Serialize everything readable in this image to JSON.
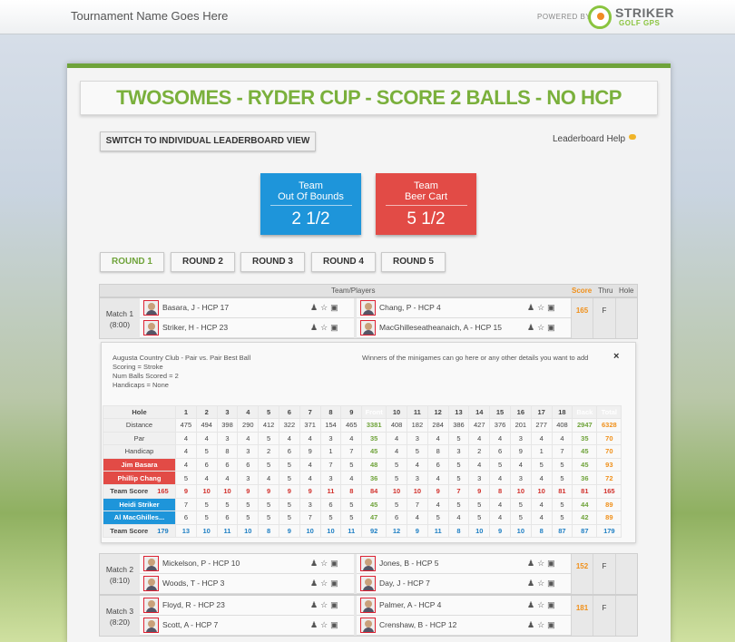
{
  "header": {
    "tournament_name": "Tournament Name Goes Here",
    "powered_by": "POWERED BY",
    "logo_word1": "STRIKER",
    "logo_word2": "GOLF GPS"
  },
  "title": "TWOSOMES - RYDER CUP - SCORE 2 BALLS - NO HCP",
  "switch_button": "SWITCH TO INDIVIDUAL LEADERBOARD VIEW",
  "help_link": "Leaderboard Help",
  "teams": [
    {
      "line1": "Team",
      "line2": "Out Of Bounds",
      "score": "2 1/2",
      "color": "#1e95da"
    },
    {
      "line1": "Team",
      "line2": "Beer Cart",
      "score": "5 1/2",
      "color": "#e24b46"
    }
  ],
  "rounds": [
    "ROUND 1",
    "ROUND 2",
    "ROUND 3",
    "ROUND 4",
    "ROUND 5"
  ],
  "active_round": "ROUND 1",
  "columns": {
    "players": "Team/Players",
    "score": "Score",
    "thru": "Thru",
    "hole": "Hole"
  },
  "matches": [
    {
      "label": "Match 1",
      "time": "(8:00)",
      "left": [
        "Basara, J - HCP 17",
        "Striker, H - HCP 23"
      ],
      "right": [
        "Chang, P - HCP 4",
        "MacGhilleseatheanaich, A - HCP 15"
      ],
      "score": "165",
      "thru": "F",
      "hole": ""
    },
    {
      "label": "Match 2",
      "time": "(8:10)",
      "left": [
        "Mickelson, P - HCP 10",
        "Woods, T - HCP 3"
      ],
      "right": [
        "Jones, B - HCP 5",
        "Day, J - HCP 7"
      ],
      "score": "152",
      "thru": "F",
      "hole": ""
    },
    {
      "label": "Match 3",
      "time": "(8:20)",
      "left": [
        "Floyd, R - HCP 23",
        "Scott, A - HCP 7"
      ],
      "right": [
        "Palmer, A - HCP 4",
        "Crenshaw, B - HCP 12"
      ],
      "score": "181",
      "thru": "F",
      "hole": ""
    }
  ],
  "details": {
    "course": "Augusta Country Club - Pair vs. Pair Best Ball",
    "scoring": "Scoring = Stroke",
    "num_balls": "Num Balls Scored = 2",
    "handicaps": "Handicaps = None",
    "minigames_note": "Winners of the minigames can go here or any other details you want to add",
    "close": "×"
  },
  "scorecard": {
    "hole_label": "Hole",
    "holes_front": [
      "1",
      "2",
      "3",
      "4",
      "5",
      "6",
      "7",
      "8",
      "9"
    ],
    "front_label": "Front",
    "holes_back": [
      "10",
      "11",
      "12",
      "13",
      "14",
      "15",
      "16",
      "17",
      "18"
    ],
    "back_label": "Back",
    "total_label": "Total",
    "rows": [
      {
        "label": "Distance",
        "front": [
          "475",
          "494",
          "398",
          "290",
          "412",
          "322",
          "371",
          "154",
          "465"
        ],
        "front_tot": "3381",
        "back": [
          "408",
          "182",
          "284",
          "386",
          "427",
          "376",
          "201",
          "277",
          "408"
        ],
        "back_tot": "2947",
        "total": "6328",
        "style": "plain"
      },
      {
        "label": "Par",
        "front": [
          "4",
          "4",
          "3",
          "4",
          "5",
          "4",
          "4",
          "3",
          "4"
        ],
        "front_tot": "35",
        "back": [
          "4",
          "3",
          "4",
          "5",
          "4",
          "4",
          "3",
          "4",
          "4"
        ],
        "back_tot": "35",
        "total": "70",
        "style": "plain"
      },
      {
        "label": "Handicap",
        "front": [
          "4",
          "5",
          "8",
          "3",
          "2",
          "6",
          "9",
          "1",
          "7"
        ],
        "front_tot": "45",
        "back": [
          "4",
          "5",
          "8",
          "3",
          "2",
          "6",
          "9",
          "1",
          "7"
        ],
        "back_tot": "45",
        "total": "70",
        "style": "plain"
      },
      {
        "label": "Jim Basara",
        "front": [
          "4",
          "6",
          "6",
          "6",
          "5",
          "5",
          "4",
          "7",
          "5"
        ],
        "front_tot": "48",
        "back": [
          "5",
          "4",
          "6",
          "5",
          "4",
          "5",
          "4",
          "5",
          "5"
        ],
        "back_tot": "45",
        "total": "93",
        "style": "red"
      },
      {
        "label": "Phillip Chang",
        "front": [
          "5",
          "4",
          "4",
          "3",
          "4",
          "5",
          "4",
          "3",
          "4"
        ],
        "front_tot": "36",
        "back": [
          "5",
          "3",
          "4",
          "5",
          "3",
          "4",
          "3",
          "4",
          "5"
        ],
        "back_tot": "36",
        "total": "72",
        "style": "red"
      },
      {
        "label": "Team Score",
        "team_total": "165",
        "front": [
          "9",
          "10",
          "10",
          "9",
          "9",
          "9",
          "9",
          "11",
          "8"
        ],
        "front_tot": "84",
        "back": [
          "10",
          "10",
          "9",
          "7",
          "9",
          "8",
          "10",
          "10",
          "81"
        ],
        "back_tot": "81",
        "total": "165",
        "style": "rteam"
      },
      {
        "label": "Heidi Striker",
        "front": [
          "7",
          "5",
          "5",
          "5",
          "5",
          "5",
          "3",
          "6",
          "5"
        ],
        "front_tot": "45",
        "back": [
          "5",
          "7",
          "4",
          "5",
          "5",
          "4",
          "5",
          "4",
          "5"
        ],
        "back_tot": "44",
        "total": "89",
        "style": "blue"
      },
      {
        "label": "Al MacGhilles...",
        "front": [
          "6",
          "5",
          "6",
          "5",
          "5",
          "5",
          "7",
          "5",
          "5"
        ],
        "front_tot": "47",
        "back": [
          "6",
          "4",
          "5",
          "4",
          "5",
          "4",
          "5",
          "4",
          "5"
        ],
        "back_tot": "42",
        "total": "89",
        "style": "blue"
      },
      {
        "label": "Team Score",
        "team_total": "179",
        "front": [
          "13",
          "10",
          "11",
          "10",
          "8",
          "9",
          "10",
          "10",
          "11"
        ],
        "front_tot": "92",
        "back": [
          "12",
          "9",
          "11",
          "8",
          "10",
          "9",
          "10",
          "8",
          "87"
        ],
        "back_tot": "87",
        "total": "179",
        "style": "bteam"
      }
    ]
  }
}
